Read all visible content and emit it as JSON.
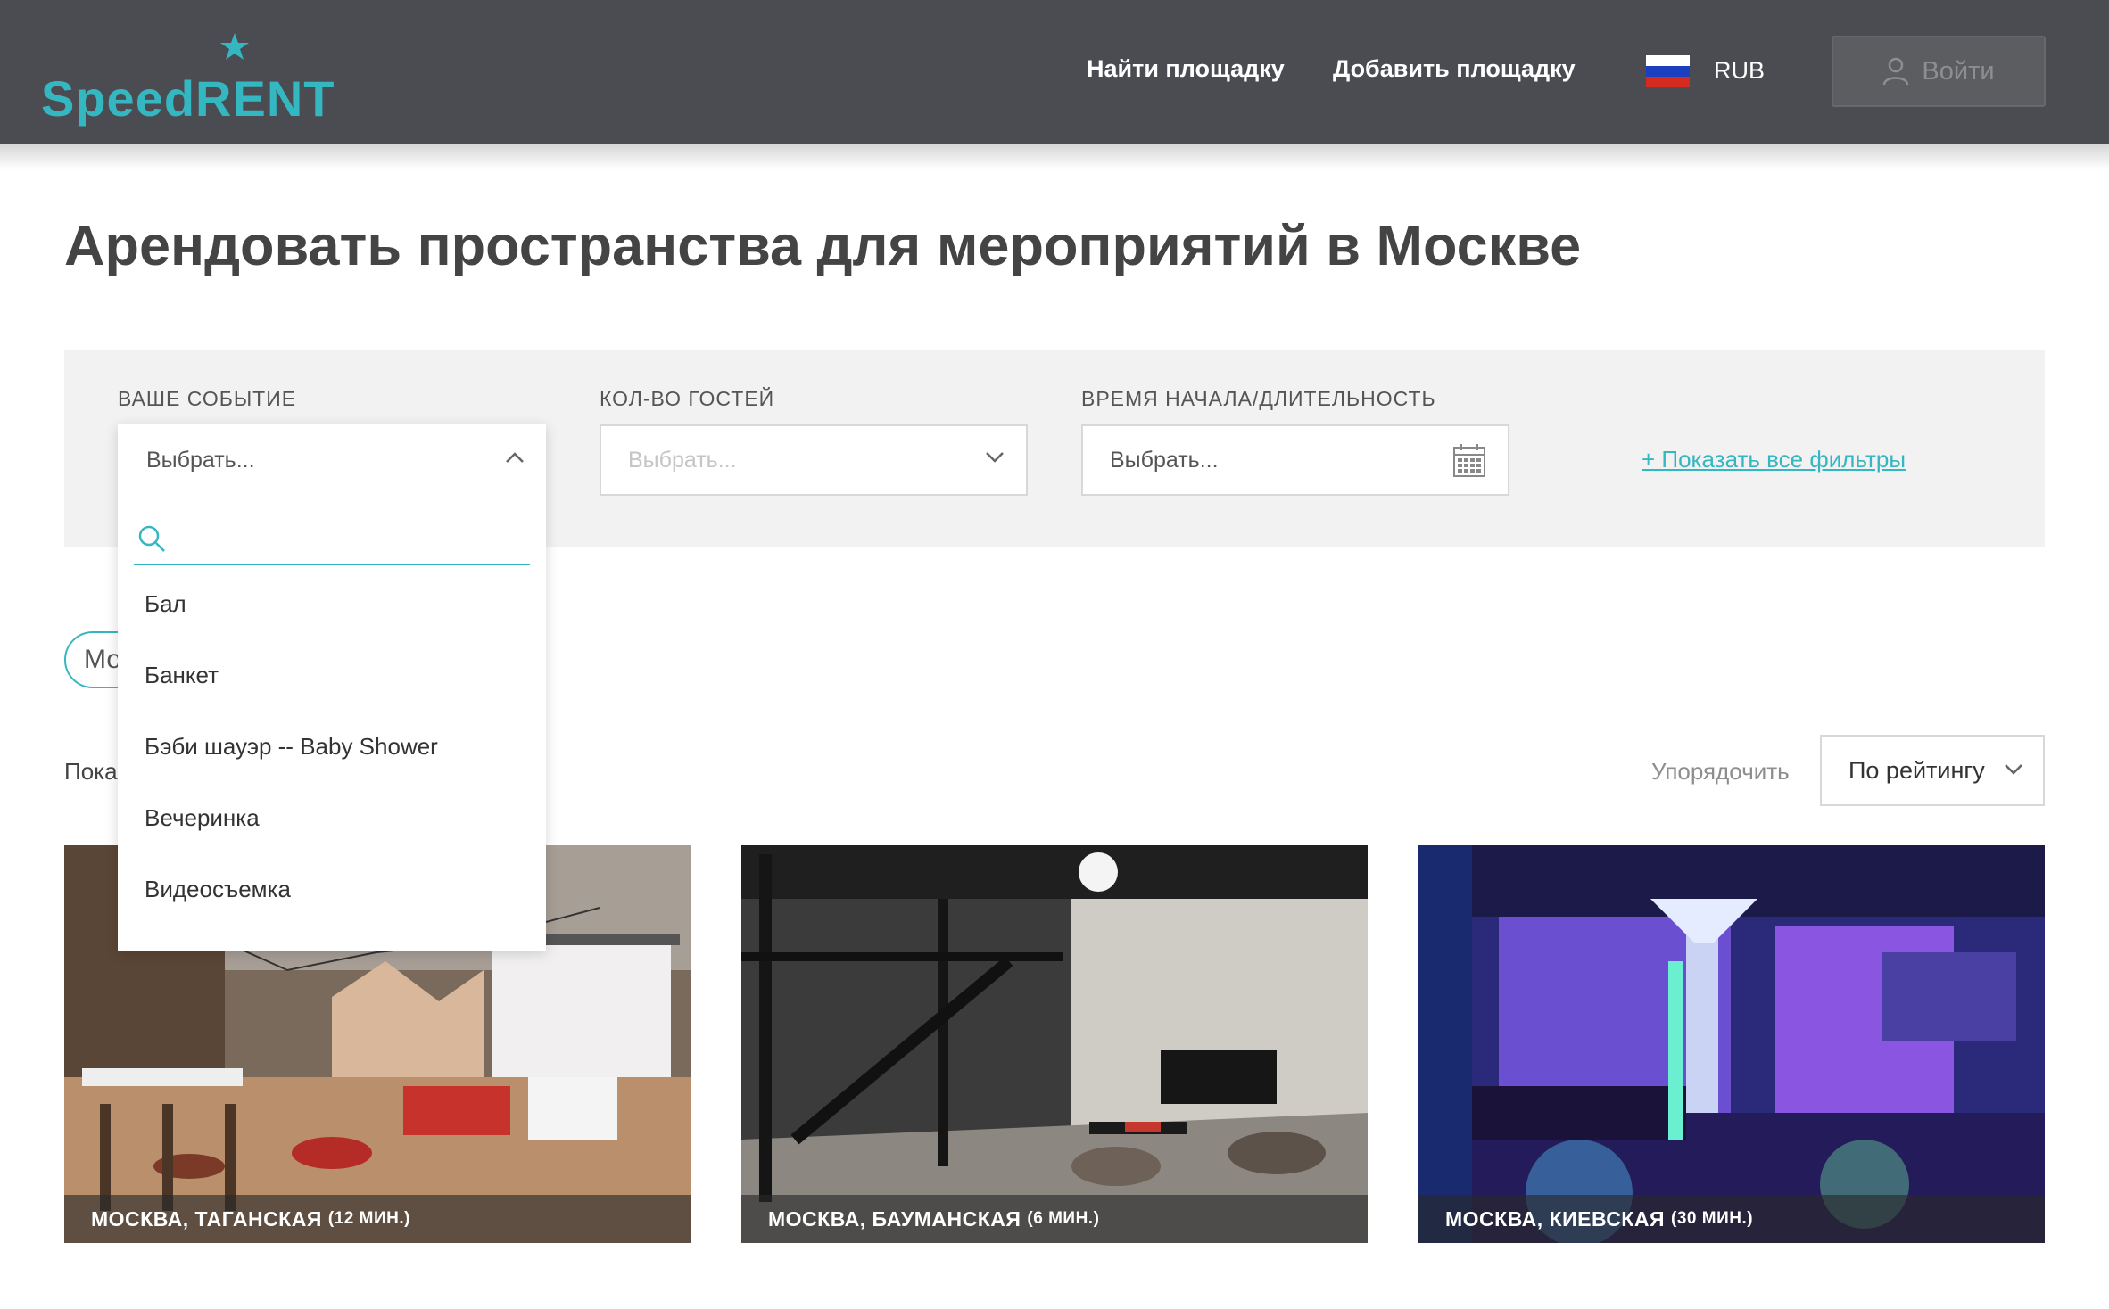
{
  "header": {
    "logo_text": "SpeedRENT",
    "nav": {
      "find": "Найти площадку",
      "add": "Добавить площадку"
    },
    "currency": "RUB",
    "login_label": "Войти",
    "brand_color": "#35b7c2",
    "bg_color": "#4a4c51"
  },
  "title": "Арендовать пространства для мероприятий в Москве",
  "filters": {
    "event": {
      "label": "ВАШЕ СОБЫТИЕ",
      "placeholder": "Выбрать..."
    },
    "guests": {
      "label": "КОЛ-ВО ГОСТЕЙ",
      "placeholder": "Выбрать..."
    },
    "time": {
      "label": "ВРЕМЯ НАЧАЛА/ДЛИТЕЛЬНОСТЬ",
      "placeholder": "Выбрать..."
    },
    "show_all": "+ Показать все фильтры"
  },
  "dropdown": {
    "items": [
      "Бал",
      "Банкет",
      "Бэби шауэр -- Baby Shower",
      "Вечеринка",
      "Видеосъемка"
    ]
  },
  "chip_text": "Мо",
  "showing_text": "Пока",
  "sort": {
    "label": "Упорядочить",
    "value": "По рейтингу"
  },
  "cards": [
    {
      "city": "МОСКВА, ТАГАНСКАЯ",
      "time": "(12 МИН.)"
    },
    {
      "city": "МОСКВА, БАУМАНСКАЯ",
      "time": "(6 МИН.)"
    },
    {
      "city": "МОСКВА, КИЕВСКАЯ",
      "time": "(30 МИН.)"
    }
  ]
}
